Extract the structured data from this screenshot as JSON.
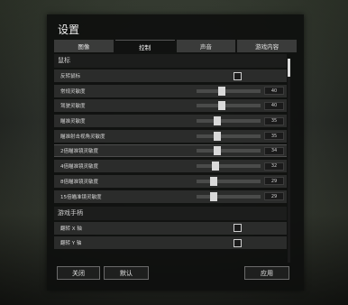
{
  "dialog": {
    "title": "设置"
  },
  "tabs": [
    {
      "label": "图像",
      "active": false
    },
    {
      "label": "控制",
      "active": true
    },
    {
      "label": "声音",
      "active": false
    },
    {
      "label": "游戏内容",
      "active": false
    }
  ],
  "sections": {
    "mouse": {
      "header": "鼠标",
      "invert_label": "反转鼠标",
      "invert_checked": false,
      "sliders": [
        {
          "label": "常规灵敏度",
          "value": "40",
          "level": 0.4
        },
        {
          "label": "驾驶灵敏度",
          "value": "40",
          "level": 0.4
        },
        {
          "label": "瞄准灵敏度",
          "value": "35",
          "level": 0.33
        },
        {
          "label": "瞄准射击视角灵敏度",
          "value": "35",
          "level": 0.33
        },
        {
          "label": "2倍瞄准镜灵敏度",
          "value": "34",
          "level": 0.32
        },
        {
          "label": "4倍瞄准镜灵敏度",
          "value": "32",
          "level": 0.3
        },
        {
          "label": "8倍瞄准镜灵敏度",
          "value": "29",
          "level": 0.27
        },
        {
          "label": "15倍瞄准镜灵敏度",
          "value": "29",
          "level": 0.27
        }
      ]
    },
    "gamepad": {
      "header": "游戏手柄",
      "invert_x_label": "翻转 X 轴",
      "invert_y_label": "翻转 Y 轴"
    }
  },
  "buttons": {
    "close": "关闭",
    "default": "默认",
    "apply": "应用"
  },
  "colors": {
    "panel_bg": "#0e0f0e",
    "row_bg": "#2b2c2b",
    "handle": "#d9d9d9"
  }
}
